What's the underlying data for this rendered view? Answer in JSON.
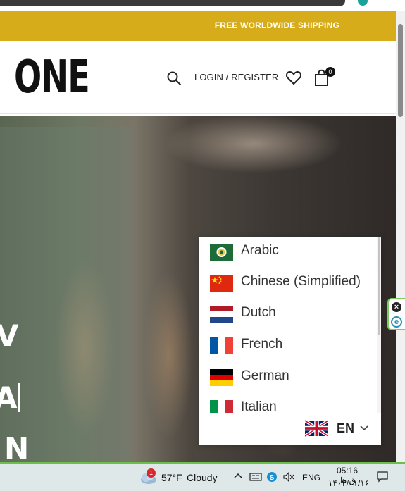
{
  "promo": {
    "text": "FREE WORLDWIDE SHIPPING",
    "color": "#d6ac1a"
  },
  "header": {
    "logo": "ONE",
    "login_label": "LOGIN / REGISTER",
    "cart_count": "0",
    "icons": [
      "search-icon",
      "heart-icon",
      "shopping-bag-icon"
    ]
  },
  "hero": {
    "letters": [
      "V",
      "A",
      "|",
      "N"
    ]
  },
  "language_switcher": {
    "options": [
      {
        "label": "Arabic",
        "flag": "arabic-flag-icon"
      },
      {
        "label": "Chinese (Simplified)",
        "flag": "china-flag-icon"
      },
      {
        "label": "Dutch",
        "flag": "netherlands-flag-icon"
      },
      {
        "label": "French",
        "flag": "france-flag-icon"
      },
      {
        "label": "German",
        "flag": "germany-flag-icon"
      },
      {
        "label": "Italian",
        "flag": "italy-flag-icon"
      }
    ],
    "current_code": "EN",
    "current_flag": "uk-flag-icon"
  },
  "taskbar": {
    "weather_badge": "1",
    "temperature": "57°F",
    "condition": "Cloudy",
    "keyboard_lang": "ENG",
    "time": "05:16 ق.ظ",
    "date": "۱۴۰۴/۰۱/۱۶"
  }
}
